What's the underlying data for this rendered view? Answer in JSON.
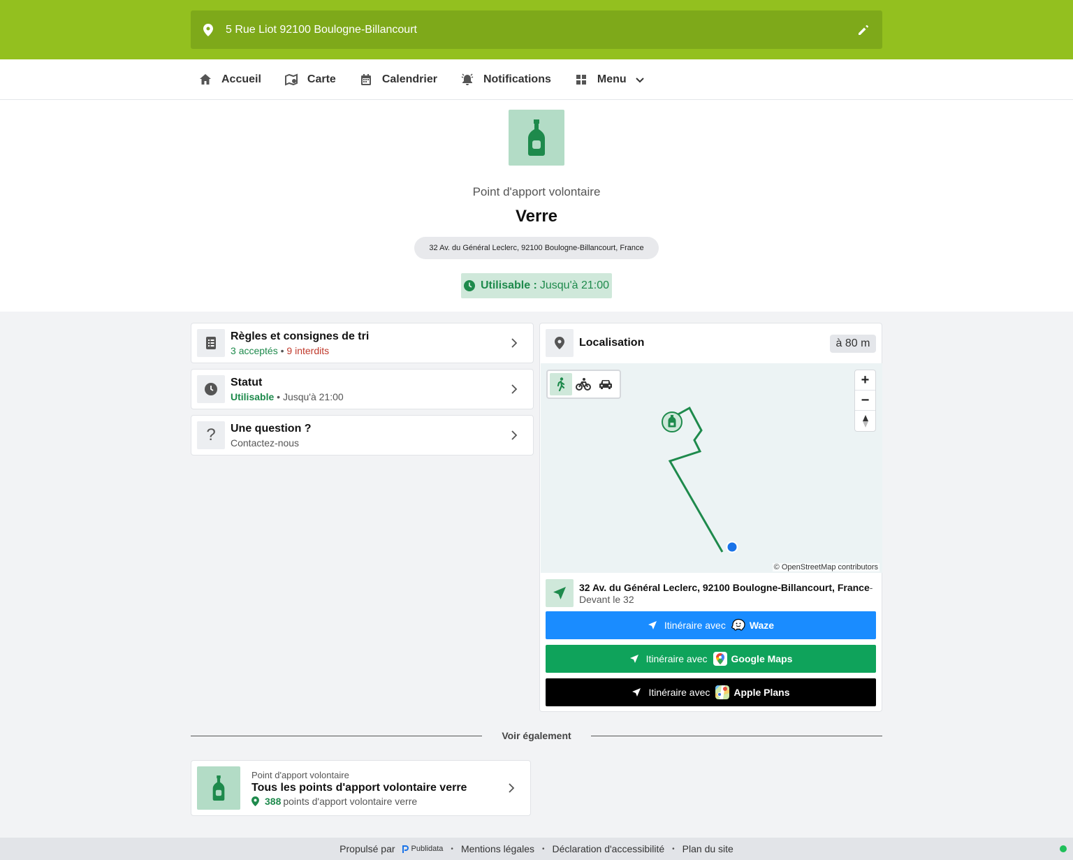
{
  "header": {
    "address": "5 Rue Liot 92100 Boulogne-Billancourt"
  },
  "nav": {
    "items": [
      {
        "label": "Accueil",
        "icon": "home-icon"
      },
      {
        "label": "Carte",
        "icon": "map-icon"
      },
      {
        "label": "Calendrier",
        "icon": "calendar-icon"
      },
      {
        "label": "Notifications",
        "icon": "bell-icon"
      },
      {
        "label": "Menu",
        "icon": "grid-icon"
      }
    ]
  },
  "hero": {
    "icon": "bottle-icon",
    "subtitle": "Point d'apport volontaire",
    "title": "Verre",
    "address": "32 Av. du Général Leclerc, 92100 Boulogne-Billancourt, France",
    "status_label": "Utilisable :",
    "status_value": "Jusqu'à 21:00"
  },
  "cards": {
    "rules": {
      "title": "Règles et consignes de tri",
      "accepted_count": "3",
      "accepted_label": "acceptés",
      "forbidden_count": "9",
      "forbidden_label": "interdits"
    },
    "status": {
      "title": "Statut",
      "state": "Utilisable",
      "until": "Jusqu'à 21:00"
    },
    "question": {
      "title": "Une question ?",
      "subtitle": "Contactez-nous"
    }
  },
  "location": {
    "title": "Localisation",
    "distance": "à 80 m",
    "attribution": "© OpenStreetMap contributors",
    "address_main": "32 Av. du Général Leclerc, 92100 Boulogne-Billancourt, France",
    "address_suffix": "-",
    "address_sub": "Devant le 32",
    "zoom_in": "+",
    "zoom_out": "−",
    "itinerary_prefix": "Itinéraire avec",
    "apps": {
      "waze": "Waze",
      "google": "Google Maps",
      "apple": "Apple Plans"
    },
    "colors": {
      "waze": "#1a8cff",
      "google": "#0fa35b",
      "apple": "#000000",
      "route": "#1e8a4c",
      "user": "#1a73e8"
    }
  },
  "see_also": {
    "heading": "Voir également",
    "card": {
      "subtitle": "Point d'apport volontaire",
      "title": "Tous les points d'apport volontaire verre",
      "count": "388",
      "count_label": "points d'apport volontaire verre"
    }
  },
  "footer": {
    "powered": "Propulsé par",
    "brand": "Publidata",
    "links": [
      "Mentions légales",
      "Déclaration d'accessibilité",
      "Plan du site"
    ]
  }
}
